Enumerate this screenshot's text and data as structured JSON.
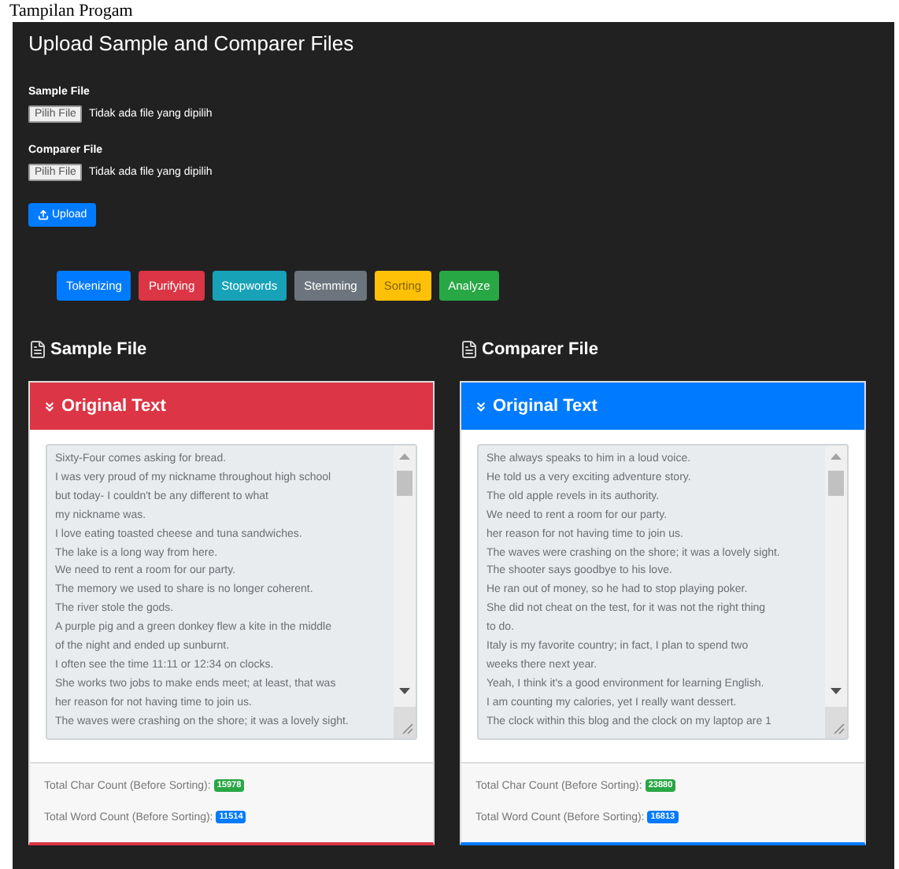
{
  "page_heading": "Tampilan Progam",
  "title": "Upload Sample and Comparer Files",
  "uploads": [
    {
      "label": "Sample File",
      "button": "Pilih File",
      "status": "Tidak ada file yang dipilih"
    },
    {
      "label": "Comparer File",
      "button": "Pilih File",
      "status": "Tidak ada file yang dipilih"
    }
  ],
  "upload_button": "Upload",
  "steps": [
    {
      "label": "Tokenizing",
      "color": "#007bff"
    },
    {
      "label": "Purifying",
      "color": "#dc3545"
    },
    {
      "label": "Stopwords",
      "color": "#17a2b8"
    },
    {
      "label": "Stemming",
      "color": "#6c757d"
    },
    {
      "label": "Sorting",
      "color": "#ffc107"
    },
    {
      "label": "Analyze",
      "color": "#28a745"
    }
  ],
  "panels": [
    {
      "heading": "Sample File",
      "card_title": "Original Text",
      "color": "#dc3545",
      "lines": [
        "Sixty-Four comes asking for bread.",
        "I was very proud of my nickname throughout high school",
        "but today- I couldn't be any different to what",
        "my nickname was.",
        "I love eating toasted cheese and tuna sandwiches.",
        "The lake is a long way from here.",
        "We need to rent a room for our party.",
        "The memory we used to share is no longer coherent.",
        "The river stole the gods.",
        "A purple pig and a green donkey flew a kite in the middle",
        "of the night and ended up sunburnt.",
        "I often see the time 11:11 or 12:34 on clocks.",
        "She works two jobs to make ends meet; at least, that was",
        "her reason for not having time to join us.",
        "The waves were crashing on the shore; it was a lovely sight."
      ],
      "stats": [
        {
          "label": "Total Char Count (Before Sorting):",
          "value": "15978",
          "color": "#28a745"
        },
        {
          "label": "Total Word Count (Before Sorting):",
          "value": "11514",
          "color": "#007bff"
        }
      ]
    },
    {
      "heading": "Comparer File",
      "card_title": "Original Text",
      "color": "#007bff",
      "lines": [
        "She always speaks to him in a loud voice.",
        "He told us a very exciting adventure story.",
        "The old apple revels in its authority.",
        "We need to rent a room for our party.",
        "her reason for not having time to join us.",
        "The waves were crashing on the shore; it was a lovely sight.",
        "The shooter says goodbye to his love.",
        "He ran out of money, so he had to stop playing poker.",
        "She did not cheat on the test, for it was not the right thing",
        "to do.",
        "Italy is my favorite country; in fact, I plan to spend two",
        "weeks there next year.",
        "Yeah, I think it's a good environment for learning English.",
        "I am counting my calories, yet I really want dessert.",
        "The clock within this blog and the clock on my laptop are 1"
      ],
      "stats": [
        {
          "label": "Total Char Count (Before Sorting):",
          "value": "23880",
          "color": "#28a745"
        },
        {
          "label": "Total Word Count (Before Sorting):",
          "value": "16813",
          "color": "#007bff"
        }
      ]
    }
  ]
}
